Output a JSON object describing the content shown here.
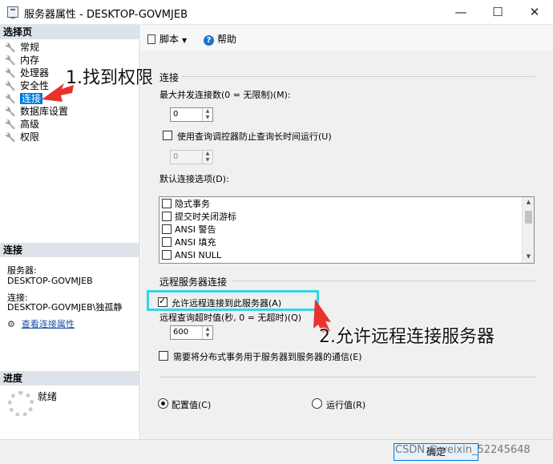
{
  "window": {
    "title": "服务器属性 - DESKTOP-GOVMJEB",
    "min": "—",
    "max": "☐",
    "close": "✕"
  },
  "left": {
    "select_page_header": "选择页",
    "pages": [
      "常规",
      "内存",
      "处理器",
      "安全性",
      "连接",
      "数据库设置",
      "高级",
      "权限"
    ],
    "selected_page": "连接",
    "connection_header": "连接",
    "server_label": "服务器:",
    "server_value": "DESKTOP-GOVMJEB",
    "conn_label": "连接:",
    "conn_value": "DESKTOP-GOVMJEB\\独孤静",
    "view_link": "查看连接属性",
    "progress_header": "进度",
    "progress_status": "就绪"
  },
  "toolbar": {
    "script": "脚本",
    "help": "帮助"
  },
  "main": {
    "group_connection": "连接",
    "max_conn_label": "最大并发连接数(0 = 无限制)(M):",
    "max_conn_value": "0",
    "governor_label": "使用查询调控器防止查询长时间运行(U)",
    "governor_checked": false,
    "governor_value": "0",
    "default_options_label": "默认连接选项(D):",
    "options": [
      {
        "label": "隐式事务",
        "checked": false
      },
      {
        "label": "提交时关闭游标",
        "checked": false
      },
      {
        "label": "ANSI 警告",
        "checked": false
      },
      {
        "label": "ANSI 填充",
        "checked": false
      },
      {
        "label": "ANSI NULL",
        "checked": false
      }
    ],
    "group_remote": "远程服务器连接",
    "allow_remote_label": "允许远程连接到此服务器(A)",
    "allow_remote_checked": true,
    "remote_timeout_label": "远程查询超时值(秒, 0 = 无超时)(Q)",
    "remote_timeout_value": "600",
    "dist_trans_label": "需要将分布式事务用于服务器到服务器的通信(E)",
    "dist_trans_checked": false,
    "radio_config": "配置值(C)",
    "radio_running": "运行值(R)",
    "radio_selected": "配置值(C)"
  },
  "annotations": {
    "step1": "1.找到权限",
    "step2": "2.允许远程连接服务器"
  },
  "footer": {
    "ok": "确定",
    "watermark": "CSDN @weixin_52245648"
  },
  "colors": {
    "selection": "#0078d7",
    "highlight_box": "#33d6e6",
    "arrow": "#e8322b"
  }
}
